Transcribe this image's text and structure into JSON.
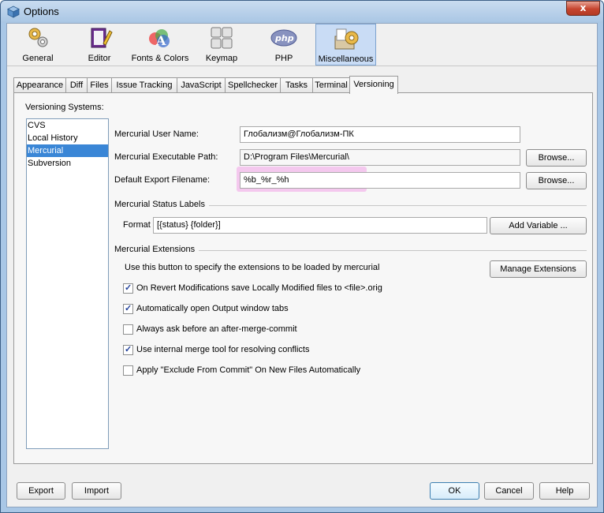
{
  "window": {
    "title": "Options",
    "close_glyph": "x"
  },
  "toolbar": {
    "items": [
      {
        "label": "General",
        "icon": "gears-icon"
      },
      {
        "label": "Editor",
        "icon": "editor-icon"
      },
      {
        "label": "Fonts & Colors",
        "icon": "fonts-colors-icon"
      },
      {
        "label": "Keymap",
        "icon": "keymap-icon"
      },
      {
        "label": "PHP",
        "icon": "php-icon"
      },
      {
        "label": "Miscellaneous",
        "icon": "miscellaneous-icon"
      }
    ],
    "selected": "Miscellaneous"
  },
  "tabs": [
    {
      "label": "Appearance"
    },
    {
      "label": "Diff"
    },
    {
      "label": "Files"
    },
    {
      "label": "Issue Tracking"
    },
    {
      "label": "JavaScript"
    },
    {
      "label": "Spellchecker"
    },
    {
      "label": "Tasks"
    },
    {
      "label": "Terminal"
    },
    {
      "label": "Versioning"
    }
  ],
  "active_tab": "Versioning",
  "versioning": {
    "systems_label": "Versioning Systems:",
    "systems": [
      "CVS",
      "Local History",
      "Mercurial",
      "Subversion"
    ],
    "selected_system": "Mercurial",
    "user_name_label": "Mercurial User Name:",
    "user_name_value": "Глобализм@Глобализм-ПК",
    "exec_path_label": "Mercurial Executable Path:",
    "exec_path_value": "D:\\Program Files\\Mercurial\\",
    "export_label": "Default Export Filename:",
    "export_value": "%b_%r_%h",
    "browse_label": "Browse...",
    "status_labels_title": "Mercurial Status Labels",
    "format_label": "Format",
    "format_value": "[{status} {folder}]",
    "add_variable_label": "Add Variable ...",
    "extensions_title": "Mercurial Extensions",
    "extensions_desc": "Use this button to specify the extensions to be loaded by mercurial",
    "manage_extensions_label": "Manage Extensions",
    "checkboxes": [
      {
        "label": "On Revert Modifications save Locally Modified files to <file>.orig",
        "checked": true
      },
      {
        "label": "Automatically open Output window tabs",
        "checked": true
      },
      {
        "label": "Always ask before an after-merge-commit",
        "checked": false
      },
      {
        "label": "Use internal merge tool for resolving conflicts",
        "checked": true
      },
      {
        "label": "Apply \"Exclude From Commit\" On New Files Automatically",
        "checked": false
      }
    ]
  },
  "footer": {
    "export_label": "Export",
    "import_label": "Import",
    "ok_label": "OK",
    "cancel_label": "Cancel",
    "help_label": "Help"
  },
  "colors": {
    "accent": "#3a86d6",
    "highlight": "#f4c8ee",
    "toolbar_selected": "#c9dcf5"
  }
}
